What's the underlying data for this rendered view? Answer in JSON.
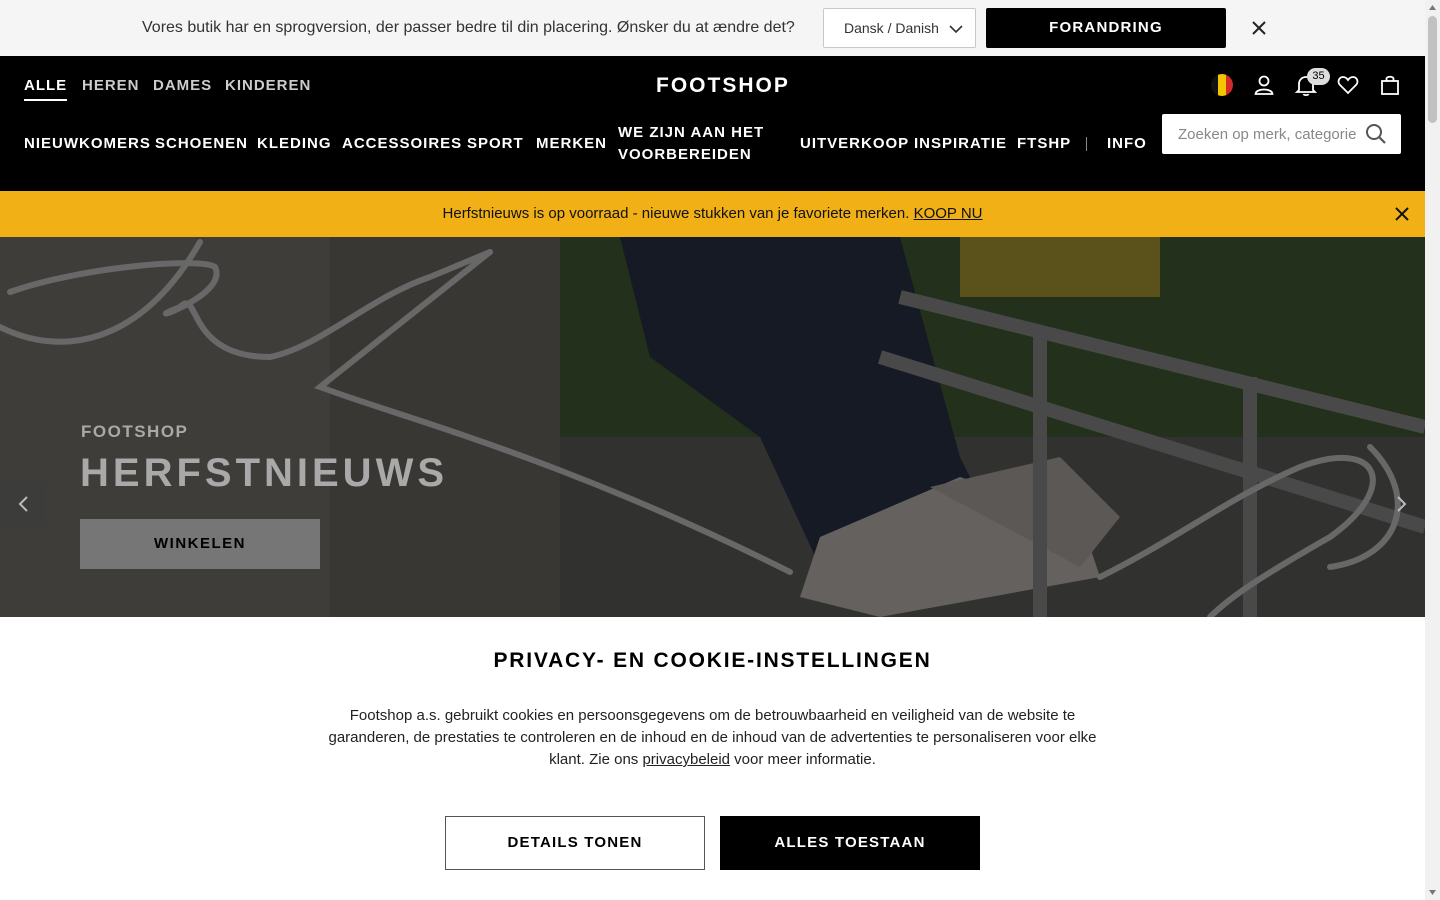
{
  "language_bar": {
    "message": "Vores butik har en sprogversion, der passer bedre til din placering. Ønsker du at ændre det?",
    "selected_language": "Dansk / Danish",
    "change_button": "FORANDRING"
  },
  "header": {
    "gender_tabs": [
      {
        "label": "ALLE",
        "active": true
      },
      {
        "label": "HEREN",
        "active": false
      },
      {
        "label": "DAMES",
        "active": false
      },
      {
        "label": "KINDEREN",
        "active": false
      }
    ],
    "logo": "FOOTSHOP",
    "notification_count": "35",
    "nav": {
      "nieuwkomers": "NIEUWKOMERS",
      "schoenen": "SCHOENEN",
      "kleding": "KLEDING",
      "accessoires": "ACCESSOIRES",
      "sport": "SPORT",
      "merken": "MERKEN",
      "voorbereiden_line1": "WE ZIJN AAN HET",
      "voorbereiden_line2": "VOORBEREIDEN",
      "uitverkoop": "UITVERKOOP",
      "inspiratie": "INSPIRATIE",
      "ftshp": "FTSHP",
      "info": "INFO"
    },
    "search_placeholder": "Zoeken op merk, categorie"
  },
  "promo": {
    "text": "Herfstnieuws is op voorraad - nieuwe stukken van je favoriete merken. ",
    "link": "KOOP NU"
  },
  "hero": {
    "eyebrow": "FOOTSHOP",
    "title": "HERFSTNIEUWS",
    "button": "WINKELEN"
  },
  "cookie": {
    "title": "PRIVACY- EN COOKIE-INSTELLINGEN",
    "text_before": "Footshop a.s. gebruikt cookies en persoonsgegevens om de betrouwbaarheid en veiligheid van de website te garanderen, de prestaties te controleren en de inhoud en de inhoud van de advertenties te personaliseren voor elke klant. Zie ons ",
    "link": "privacybeleid",
    "text_after": " voor meer informatie.",
    "details_button": "DETAILS TONEN",
    "allow_button": "ALLES TOESTAAN"
  },
  "colors": {
    "promo_bg": "#f0b016",
    "header_bg": "#000000",
    "accent_button": "#000000"
  },
  "icons": [
    "chevron-down-icon",
    "close-icon",
    "flag-belgium-icon",
    "user-icon",
    "bell-icon",
    "heart-icon",
    "bag-icon",
    "search-icon",
    "arrow-left-icon",
    "arrow-right-icon"
  ]
}
